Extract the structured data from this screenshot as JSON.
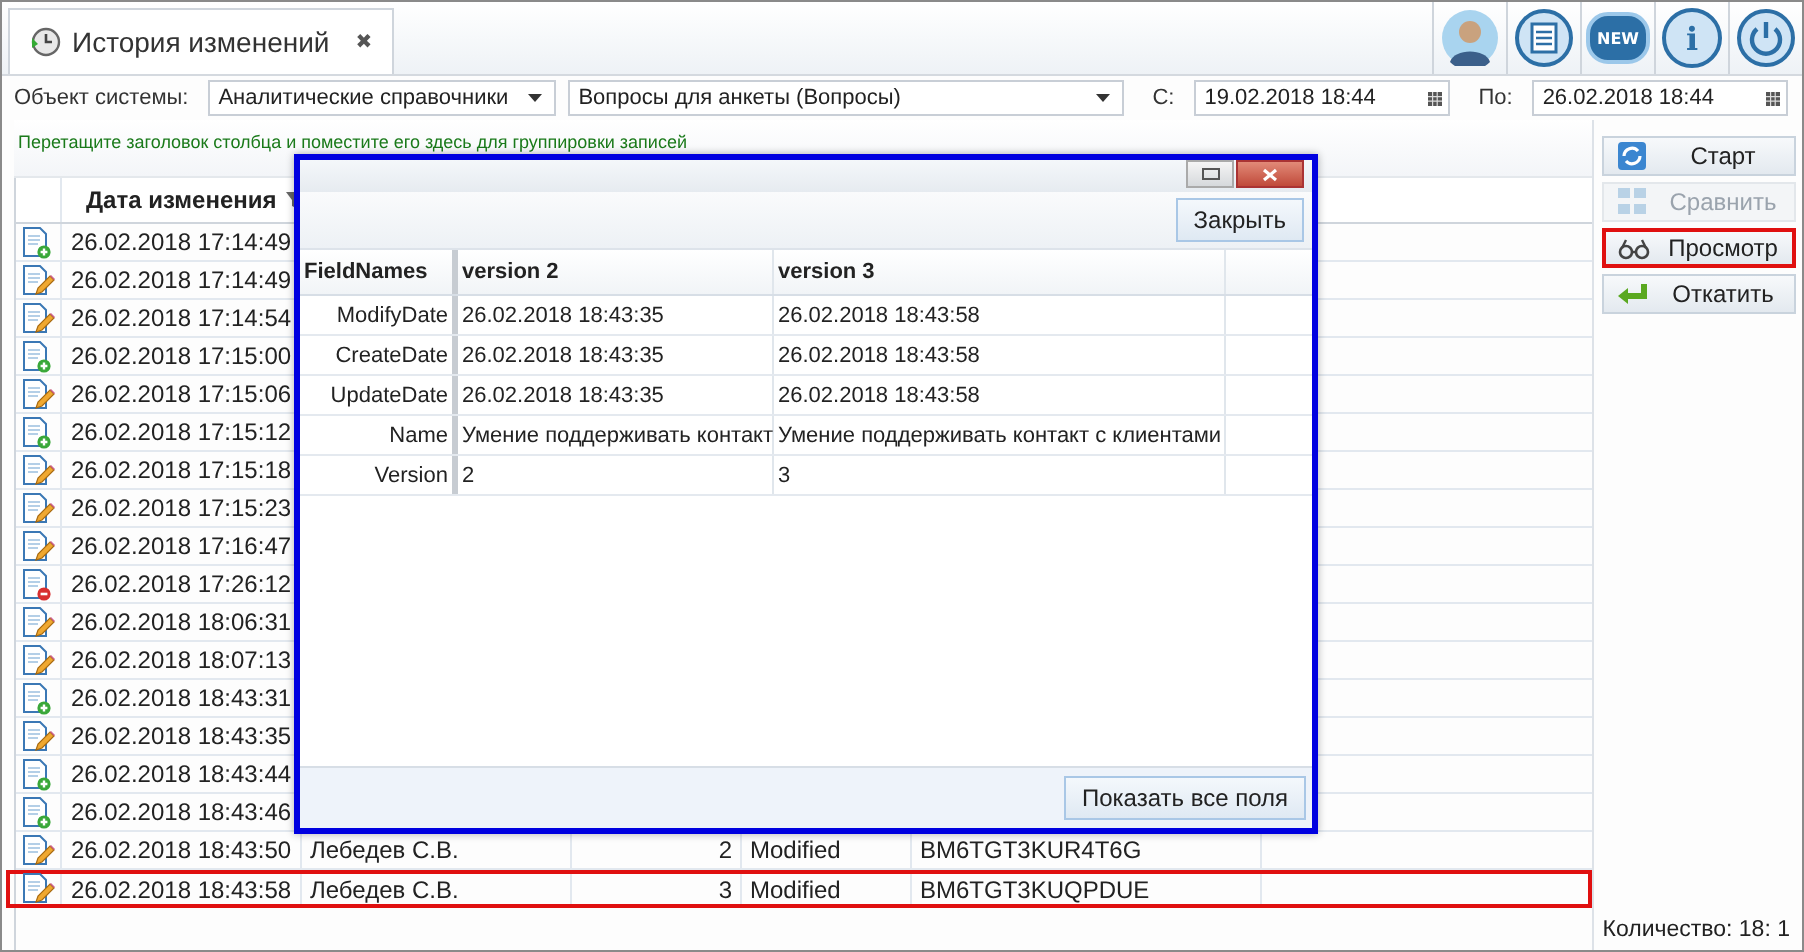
{
  "tab": {
    "title": "История изменений",
    "close": "✖"
  },
  "toolbar_icons": [
    {
      "kind": "avatar"
    },
    {
      "kind": "list"
    },
    {
      "kind": "badge",
      "label": "NEW"
    },
    {
      "kind": "info",
      "label": "i"
    },
    {
      "kind": "power"
    }
  ],
  "filter": {
    "object_label": "Объект системы:",
    "object_value": "Аналитические справочники",
    "entity_value": "Вопросы для анкеты (Вопросы)",
    "from_label": "С:",
    "from_value": "19.02.2018 18:44",
    "to_label": "По:",
    "to_value": "26.02.2018 18:44"
  },
  "group_hint": "Перетащите заголовок столбца и поместите его здесь для группировки записей",
  "table": {
    "columns": [
      "Дата изменения"
    ],
    "rows": [
      {
        "kind": "added",
        "date": "26.02.2018 17:14:49",
        "highlighted": false
      },
      {
        "kind": "edited",
        "date": "26.02.2018 17:14:49",
        "highlighted": false
      },
      {
        "kind": "edited",
        "date": "26.02.2018 17:14:54",
        "highlighted": false
      },
      {
        "kind": "added",
        "date": "26.02.2018 17:15:00",
        "highlighted": false
      },
      {
        "kind": "edited",
        "date": "26.02.2018 17:15:06",
        "highlighted": false
      },
      {
        "kind": "added",
        "date": "26.02.2018 17:15:12",
        "highlighted": false
      },
      {
        "kind": "edited",
        "date": "26.02.2018 17:15:18",
        "highlighted": false
      },
      {
        "kind": "edited",
        "date": "26.02.2018 17:15:23",
        "highlighted": false
      },
      {
        "kind": "edited",
        "date": "26.02.2018 17:16:47",
        "highlighted": false
      },
      {
        "kind": "deleted",
        "date": "26.02.2018 17:26:12",
        "highlighted": false
      },
      {
        "kind": "edited",
        "date": "26.02.2018 18:06:31",
        "highlighted": false
      },
      {
        "kind": "edited",
        "date": "26.02.2018 18:07:13",
        "highlighted": false
      },
      {
        "kind": "added",
        "date": "26.02.2018 18:43:31",
        "highlighted": false
      },
      {
        "kind": "edited",
        "date": "26.02.2018 18:43:35",
        "highlighted": false
      },
      {
        "kind": "added",
        "date": "26.02.2018 18:43:44",
        "highlighted": false
      },
      {
        "kind": "added",
        "date": "26.02.2018 18:43:46",
        "highlighted": false
      },
      {
        "kind": "edited",
        "date": "26.02.2018 18:43:50",
        "user": "Лебедев С.В.",
        "version": "2",
        "operation": "Modified",
        "id": "BM6TGT3KUR4T6G",
        "highlighted": false
      },
      {
        "kind": "edited",
        "date": "26.02.2018 18:43:58",
        "user": "Лебедев С.В.",
        "version": "3",
        "operation": "Modified",
        "id": "BM6TGT3KUQPDUE",
        "highlighted": true
      }
    ]
  },
  "actions": [
    {
      "label": "Старт",
      "disabled": false,
      "highlighted": false
    },
    {
      "label": "Сравнить",
      "disabled": true,
      "highlighted": false
    },
    {
      "label": "Просмотр",
      "disabled": false,
      "highlighted": true
    },
    {
      "label": "Откатить",
      "disabled": false,
      "highlighted": false
    }
  ],
  "status_bar": "Количество: 18: 1",
  "dialog": {
    "close_button": "Закрыть",
    "columns": [
      "FieldNames",
      "version 2",
      "version 3"
    ],
    "rows": [
      [
        "ModifyDate",
        "26.02.2018 18:43:35",
        "26.02.2018 18:43:58"
      ],
      [
        "CreateDate",
        "26.02.2018 18:43:35",
        "26.02.2018 18:43:58"
      ],
      [
        "UpdateDate",
        "26.02.2018 18:43:35",
        "26.02.2018 18:43:58"
      ],
      [
        "Name",
        "Умение поддерживать контакт",
        "Умение поддерживать контакт с клиентами"
      ],
      [
        "Version",
        "2",
        "3"
      ]
    ],
    "show_all_button": "Показать все поля"
  }
}
